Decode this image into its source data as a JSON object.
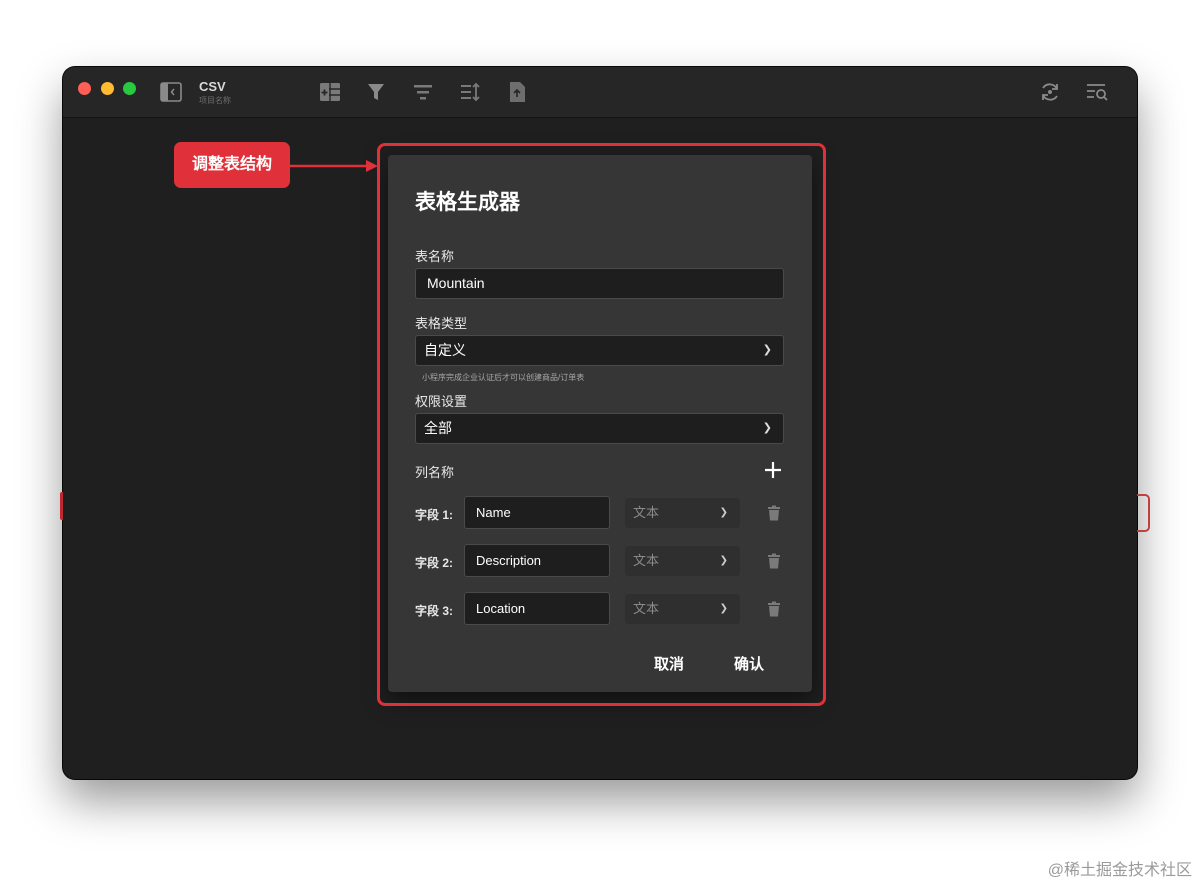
{
  "window": {
    "app_title": "CSV",
    "app_subtitle": "项目名称",
    "traffic_lights": [
      "close",
      "minimize",
      "zoom"
    ],
    "toolbar_icons": [
      "sidebar-toggle-icon",
      "add-table-icon",
      "filter-icon",
      "group-icon",
      "sort-icon",
      "export-icon",
      "sync-icon",
      "search-list-icon"
    ]
  },
  "dialog": {
    "title": "表格生成器",
    "table_name": {
      "label": "表名称",
      "value": "Mountain"
    },
    "table_type": {
      "label": "表格类型",
      "value": "自定义",
      "hint": "小程序完成企业认证后才可以创建商品/订单表"
    },
    "permissions": {
      "label": "权限设置",
      "value": "全部"
    },
    "columns": {
      "label": "列名称",
      "fields": [
        {
          "label": "字段 1:",
          "name": "Name",
          "type": "文本"
        },
        {
          "label": "字段 2:",
          "name": "Description",
          "type": "文本"
        },
        {
          "label": "字段 3:",
          "name": "Location",
          "type": "文本"
        }
      ]
    },
    "cancel_label": "取消",
    "confirm_label": "确认"
  },
  "annotation": {
    "tag": "调整表结构",
    "color": "#e0313a"
  },
  "watermark": "@稀土掘金技术社区",
  "colors": {
    "window_bg": "#1f1f1f",
    "dialog_bg": "#363636",
    "input_bg": "#1e1e1e",
    "accent_red": "#e0313a"
  }
}
